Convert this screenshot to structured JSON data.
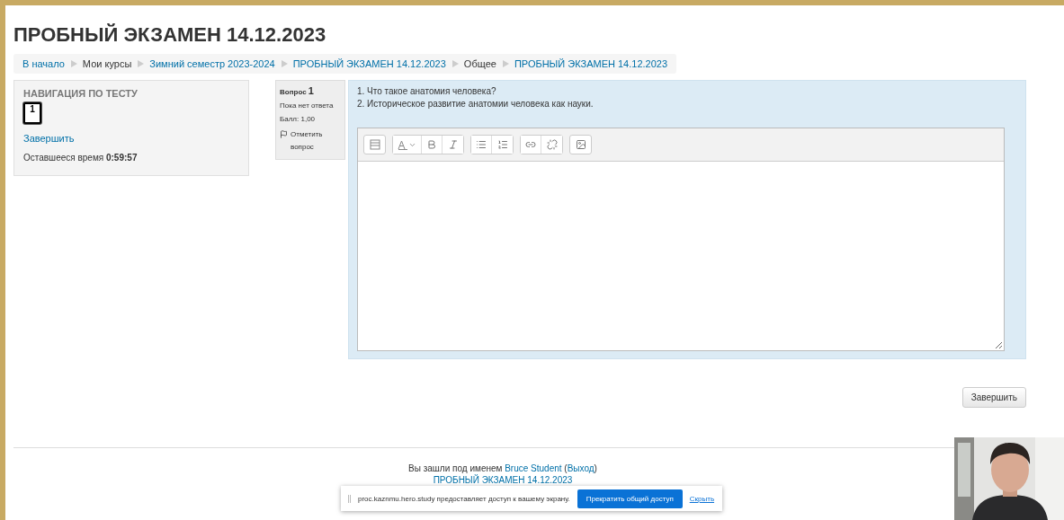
{
  "page_title": "ПРОБНЫЙ ЭКЗАМЕН 14.12.2023",
  "breadcrumb": [
    {
      "label": "В начало",
      "kind": "link"
    },
    {
      "label": "Мои курсы",
      "kind": "text"
    },
    {
      "label": "Зимний семестр 2023-2024",
      "kind": "link"
    },
    {
      "label": "ПРОБНЫЙ ЭКЗАМЕН 14.12.2023",
      "kind": "link"
    },
    {
      "label": "Общее",
      "kind": "text"
    },
    {
      "label": "ПРОБНЫЙ ЭКЗАМЕН 14.12.2023",
      "kind": "link"
    }
  ],
  "quiz_navigation": {
    "title": "НАВИГАЦИЯ ПО ТЕСТУ",
    "questions": [
      {
        "number": "1",
        "selected": true
      }
    ],
    "finish_link": "Завершить",
    "time_left_label": "Оставшееся время",
    "time_left": "0:59:57"
  },
  "question": {
    "label": "Вопрос",
    "number": "1",
    "status": "Пока нет ответа",
    "mark": "Балл: 1,00",
    "flag_label": "Отметить вопрос",
    "lines": [
      "1. Что такое анатомия человека?",
      "2. Историческое развитие анатомии человека как науки."
    ]
  },
  "finish_button": "Завершить",
  "footer": {
    "login_line": [
      {
        "text": "Вы зашли под именем ",
        "kind": "text"
      },
      {
        "text": "Bruce Student",
        "kind": "link"
      },
      {
        "text": " (",
        "kind": "text"
      },
      {
        "text": "Выход",
        "kind": "link"
      },
      {
        "text": ")",
        "kind": "text"
      }
    ],
    "course_link": "ПРОБНЫЙ ЭКЗАМЕН 14.12.2023"
  },
  "share_bar": {
    "message": "proc.kaznmu.hero.study предоставляет доступ к вашему экрану.",
    "stop_button": "Прекратить общий доступ",
    "hide_link": "Скрыть"
  }
}
